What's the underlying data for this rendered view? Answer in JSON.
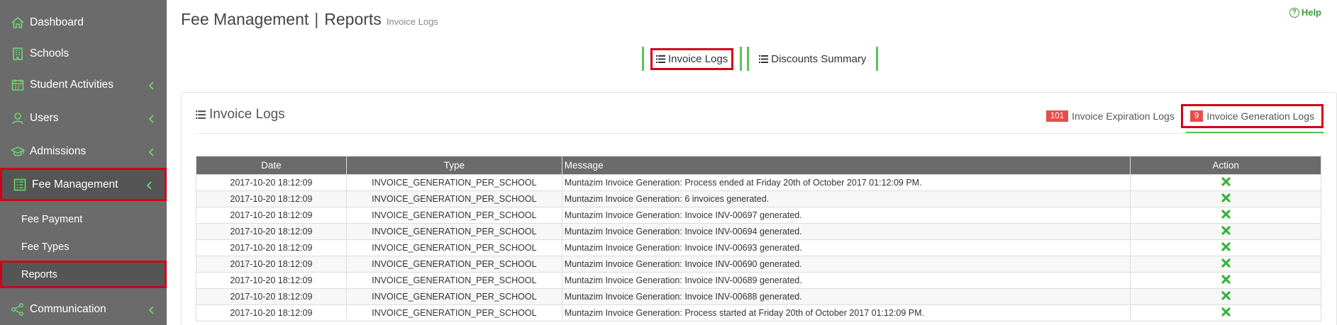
{
  "sidebar": {
    "items": [
      {
        "label": "Dashboard"
      },
      {
        "label": "Schools"
      },
      {
        "label": "Student Activities"
      },
      {
        "label": "Users"
      },
      {
        "label": "Admissions"
      },
      {
        "label": "Fee Management"
      },
      {
        "label": "Communication"
      }
    ],
    "sub_items": [
      {
        "label": "Fee Payment"
      },
      {
        "label": "Fee Types"
      },
      {
        "label": "Reports"
      }
    ]
  },
  "header": {
    "title": "Fee Management",
    "separator": "|",
    "subtitle": "Reports",
    "breadcrumb": "Invoice Logs",
    "help": "Help"
  },
  "top_tabs": [
    {
      "label": "Invoice Logs"
    },
    {
      "label": "Discounts Summary"
    }
  ],
  "panel": {
    "title": "Invoice Logs",
    "tabs": [
      {
        "count": "101",
        "label": "Invoice Expiration Logs"
      },
      {
        "count": "9",
        "label": "Invoice Generation Logs"
      }
    ]
  },
  "table": {
    "columns": [
      "Date",
      "Type",
      "Message",
      "Action"
    ],
    "rows": [
      {
        "date": "2017-10-20 18:12:09",
        "type": "INVOICE_GENERATION_PER_SCHOOL",
        "message": "Muntazim Invoice Generation: Process ended at Friday 20th of October 2017 01:12:09 PM."
      },
      {
        "date": "2017-10-20 18:12:09",
        "type": "INVOICE_GENERATION_PER_SCHOOL",
        "message": "Muntazim Invoice Generation: 6 invoices generated."
      },
      {
        "date": "2017-10-20 18:12:09",
        "type": "INVOICE_GENERATION_PER_SCHOOL",
        "message": "Muntazim Invoice Generation: Invoice INV-00697 generated."
      },
      {
        "date": "2017-10-20 18:12:09",
        "type": "INVOICE_GENERATION_PER_SCHOOL",
        "message": "Muntazim Invoice Generation: Invoice INV-00694 generated."
      },
      {
        "date": "2017-10-20 18:12:09",
        "type": "INVOICE_GENERATION_PER_SCHOOL",
        "message": "Muntazim Invoice Generation: Invoice INV-00693 generated."
      },
      {
        "date": "2017-10-20 18:12:09",
        "type": "INVOICE_GENERATION_PER_SCHOOL",
        "message": "Muntazim Invoice Generation: Invoice INV-00690 generated."
      },
      {
        "date": "2017-10-20 18:12:09",
        "type": "INVOICE_GENERATION_PER_SCHOOL",
        "message": "Muntazim Invoice Generation: Invoice INV-00689 generated."
      },
      {
        "date": "2017-10-20 18:12:09",
        "type": "INVOICE_GENERATION_PER_SCHOOL",
        "message": "Muntazim Invoice Generation: Invoice INV-00688 generated."
      },
      {
        "date": "2017-10-20 18:12:09",
        "type": "INVOICE_GENERATION_PER_SCHOOL",
        "message": "Muntazim Invoice Generation: Process started at Friday 20th of October 2017 01:12:09 PM."
      }
    ]
  },
  "colors": {
    "sidebar_bg": "#6b6b6b",
    "accent_green": "#5ac45a",
    "highlight_red": "#d0021b",
    "badge_red": "#e84c4c"
  },
  "icons": {
    "dashboard": "home-icon",
    "schools": "building-icon",
    "student_activities": "calendar-icon",
    "users": "user-icon",
    "admissions": "graduation-cap-icon",
    "fee_management": "ledger-icon",
    "communication": "share-icon",
    "action": "delete-x-icon"
  }
}
